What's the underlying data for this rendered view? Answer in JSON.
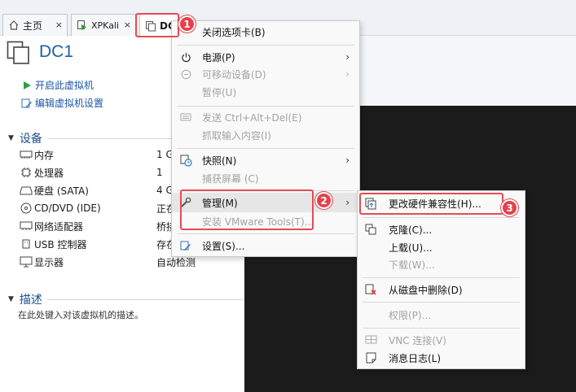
{
  "tabs": [
    {
      "label": "主页",
      "icon": "home-icon"
    },
    {
      "label": "XPKali",
      "icon": "vm-running-icon"
    },
    {
      "label": "DC",
      "icon": "vm-icon"
    }
  ],
  "tab_close": "×",
  "vm": {
    "title": "DC1"
  },
  "actions": {
    "power_on": "开启此虚拟机",
    "edit_settings": "编辑虚拟机设置"
  },
  "devices": {
    "heading": "设备",
    "rows": [
      {
        "name": "内存",
        "value": "1 G",
        "icon": "memory-icon"
      },
      {
        "name": "处理器",
        "value": "1",
        "icon": "cpu-icon"
      },
      {
        "name": "硬盘 (SATA)",
        "value": "4 G",
        "icon": "hard-disk-icon"
      },
      {
        "name": "CD/DVD (IDE)",
        "value": "正在",
        "icon": "cd-icon"
      },
      {
        "name": "网络适配器",
        "value": "桥接",
        "icon": "network-icon"
      },
      {
        "name": "USB 控制器",
        "value": "存在",
        "icon": "usb-icon"
      },
      {
        "name": "显示器",
        "value": "自动检测",
        "icon": "monitor-icon"
      }
    ]
  },
  "description": {
    "heading": "描述",
    "placeholder": "在此处键入对该虚拟机的描述。"
  },
  "context_menu": {
    "items": [
      {
        "label": "关闭选项卡(B)"
      },
      {
        "label": "电源(P)"
      },
      {
        "label": "可移动设备(D)"
      },
      {
        "label": "暂停(U)"
      },
      {
        "label": "发送 Ctrl+Alt+Del(E)"
      },
      {
        "label": "抓取输入内容(I)"
      },
      {
        "label": "快照(N)"
      },
      {
        "label": "捕获屏幕 (C)"
      },
      {
        "label": "管理(M)"
      },
      {
        "label": "安装 VMware Tools(T)..."
      },
      {
        "label": "设置(S)..."
      }
    ],
    "submenu_arrow": "›"
  },
  "submenu": {
    "items": [
      {
        "label": "更改硬件兼容性(H)..."
      },
      {
        "label": "克隆(C)..."
      },
      {
        "label": "上载(U)..."
      },
      {
        "label": "下载(W)..."
      },
      {
        "label": "从磁盘中删除(D)"
      },
      {
        "label": "权限(P)..."
      },
      {
        "label": "VNC 连接(V)"
      },
      {
        "label": "消息日志(L)"
      }
    ]
  },
  "markers": [
    "1",
    "2",
    "3"
  ],
  "colors": {
    "accent": "#1e5fa8",
    "highlight": "#e64b55",
    "console": "#1b1b1b"
  }
}
